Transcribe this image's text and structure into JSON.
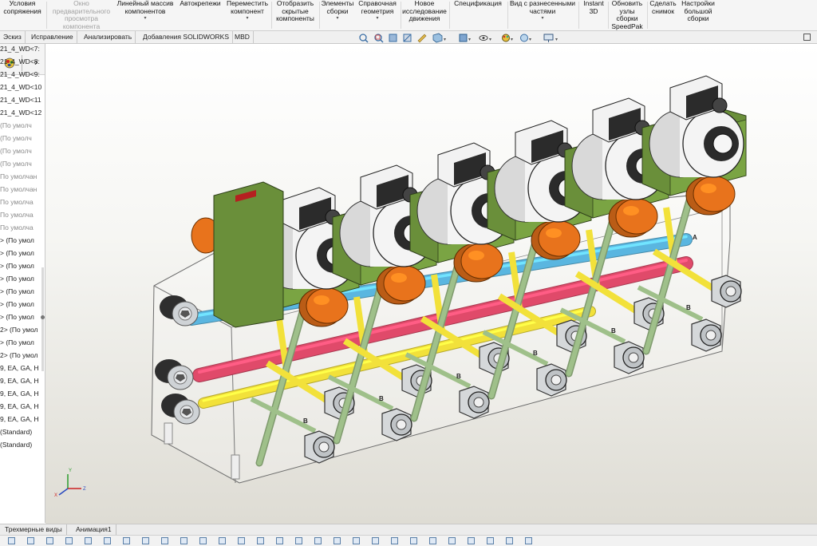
{
  "ribbon": {
    "groups": [
      {
        "label": "Условия\nсопряжения",
        "disabled": false,
        "arrow": false
      },
      {
        "label": "Окно\nпредварительного\nпросмотра\nкомпонента",
        "disabled": true,
        "arrow": false
      },
      {
        "label": "Линейный массив\nкомпонентов",
        "disabled": false,
        "arrow": true
      },
      {
        "label": "Автокрепежи",
        "disabled": false,
        "arrow": false
      },
      {
        "label": "Переместить\nкомпонент",
        "disabled": false,
        "arrow": true
      },
      {
        "label": "Отобразить\nскрытые\nкомпоненты",
        "disabled": false,
        "arrow": false
      },
      {
        "label": "Элементы\nсборки",
        "disabled": false,
        "arrow": true
      },
      {
        "label": "Справочная\nгеометрия",
        "disabled": false,
        "arrow": true
      },
      {
        "label": "Новое\nисследование\nдвижения",
        "disabled": false,
        "arrow": false
      },
      {
        "label": "Спецификация",
        "disabled": false,
        "arrow": false
      },
      {
        "label": "Вид с разнесенными\nчастями",
        "disabled": false,
        "arrow": true
      },
      {
        "label": "Instant\n3D",
        "disabled": false,
        "arrow": false
      },
      {
        "label": "Обновить\nузлы\nсборки\nSpeedPak",
        "disabled": false,
        "arrow": false
      },
      {
        "label": "Сделать\nснимок",
        "disabled": false,
        "arrow": false
      },
      {
        "label": "Настройки\nбольшой\nсборки",
        "disabled": false,
        "arrow": false
      }
    ]
  },
  "tabs": [
    "Эскиз",
    "Исправление",
    "Анализировать",
    "Добавления SOLIDWORKS",
    "MBD"
  ],
  "left_panel": {
    "collapse_glyph": "›",
    "items": [
      {
        "text": "21_4_WD<7:",
        "dim": false
      },
      {
        "text": "21_4_WD<8:",
        "dim": false
      },
      {
        "text": "21_4_WD<9:",
        "dim": false
      },
      {
        "text": "21_4_WD<10",
        "dim": false
      },
      {
        "text": "21_4_WD<11",
        "dim": false
      },
      {
        "text": "21_4_WD<12",
        "dim": false
      },
      {
        "text": "(По умолч",
        "dim": true
      },
      {
        "text": "(По умолч",
        "dim": true
      },
      {
        "text": "(По умолч",
        "dim": true
      },
      {
        "text": "(По умолч",
        "dim": true
      },
      {
        "text": "По умолчан",
        "dim": true
      },
      {
        "text": "По умолчан",
        "dim": true
      },
      {
        "text": "По умолча",
        "dim": true
      },
      {
        "text": "По умолча",
        "dim": true
      },
      {
        "text": "По умолча",
        "dim": true
      },
      {
        "text": "> (По умол",
        "dim": false
      },
      {
        "text": "> (По умол",
        "dim": false
      },
      {
        "text": "> (По умол",
        "dim": false
      },
      {
        "text": "> (По умол",
        "dim": false
      },
      {
        "text": "> (По умол",
        "dim": false
      },
      {
        "text": "> (По умол",
        "dim": false
      },
      {
        "text": "> (По умол",
        "dim": false
      },
      {
        "text": "2> (По умол",
        "dim": false
      },
      {
        "text": "> (По умол",
        "dim": false
      },
      {
        "text": "2> (По умол",
        "dim": false
      },
      {
        "text": "9, EA, GA, H",
        "dim": false
      },
      {
        "text": "9, EA, GA, H",
        "dim": false
      },
      {
        "text": "9, EA, GA, H",
        "dim": false
      },
      {
        "text": "9, EA, GA, H",
        "dim": false
      },
      {
        "text": "9, EA, GA, H",
        "dim": false
      },
      {
        "text": "(Standard)",
        "dim": false
      },
      {
        "text": "(Standard)",
        "dim": false
      }
    ]
  },
  "viewport": {
    "valve_count": 6,
    "port_labels": [
      "A",
      "B",
      "B",
      "B",
      "B",
      "B",
      "B"
    ],
    "triad_axes": [
      "Y",
      "Z",
      "X"
    ],
    "colors": {
      "manifold_green": "#6a8f3a",
      "coil_white": "#f4f4f4",
      "solenoid_black": "#2b2b2b",
      "orange_cap": "#e8731c",
      "pipe_blue": "#5ab6e0",
      "pipe_red": "#e04a6a",
      "pipe_yellow": "#f2e13a",
      "pipe_green": "#9fc08a",
      "fitting_silver": "#cfd3d6"
    }
  },
  "bottom_tabs": [
    "Трехмерные виды",
    "Анимация1"
  ]
}
